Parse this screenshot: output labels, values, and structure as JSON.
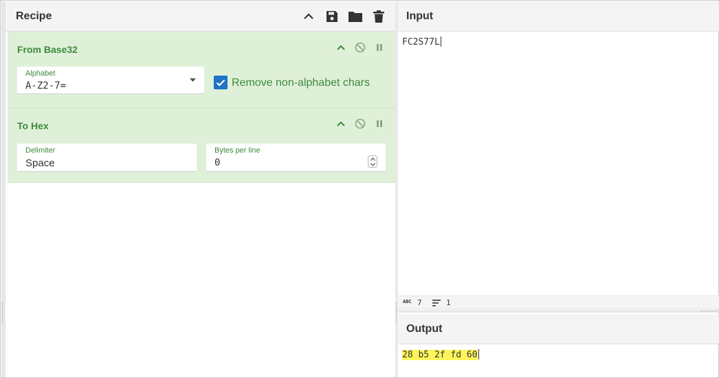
{
  "recipe": {
    "title": "Recipe",
    "operations": [
      {
        "name": "From Base32",
        "alphabet_label": "Alphabet",
        "alphabet_value": "A-Z2-7=",
        "remove_label": "Remove non-alphabet chars",
        "remove_checked": true
      },
      {
        "name": "To Hex",
        "delimiter_label": "Delimiter",
        "delimiter_value": "Space",
        "bpl_label": "Bytes per line",
        "bpl_value": "0"
      }
    ]
  },
  "input": {
    "title": "Input",
    "text": "FC2S77L",
    "stats": {
      "length": "7",
      "lines": "1"
    }
  },
  "output": {
    "title": "Output",
    "text": "28 b5 2f fd 60"
  },
  "colors": {
    "op_bg": "#dff0d8",
    "op_text": "#3c8a3c",
    "checkbox": "#1e73c4",
    "highlight": "#fdf55a"
  }
}
